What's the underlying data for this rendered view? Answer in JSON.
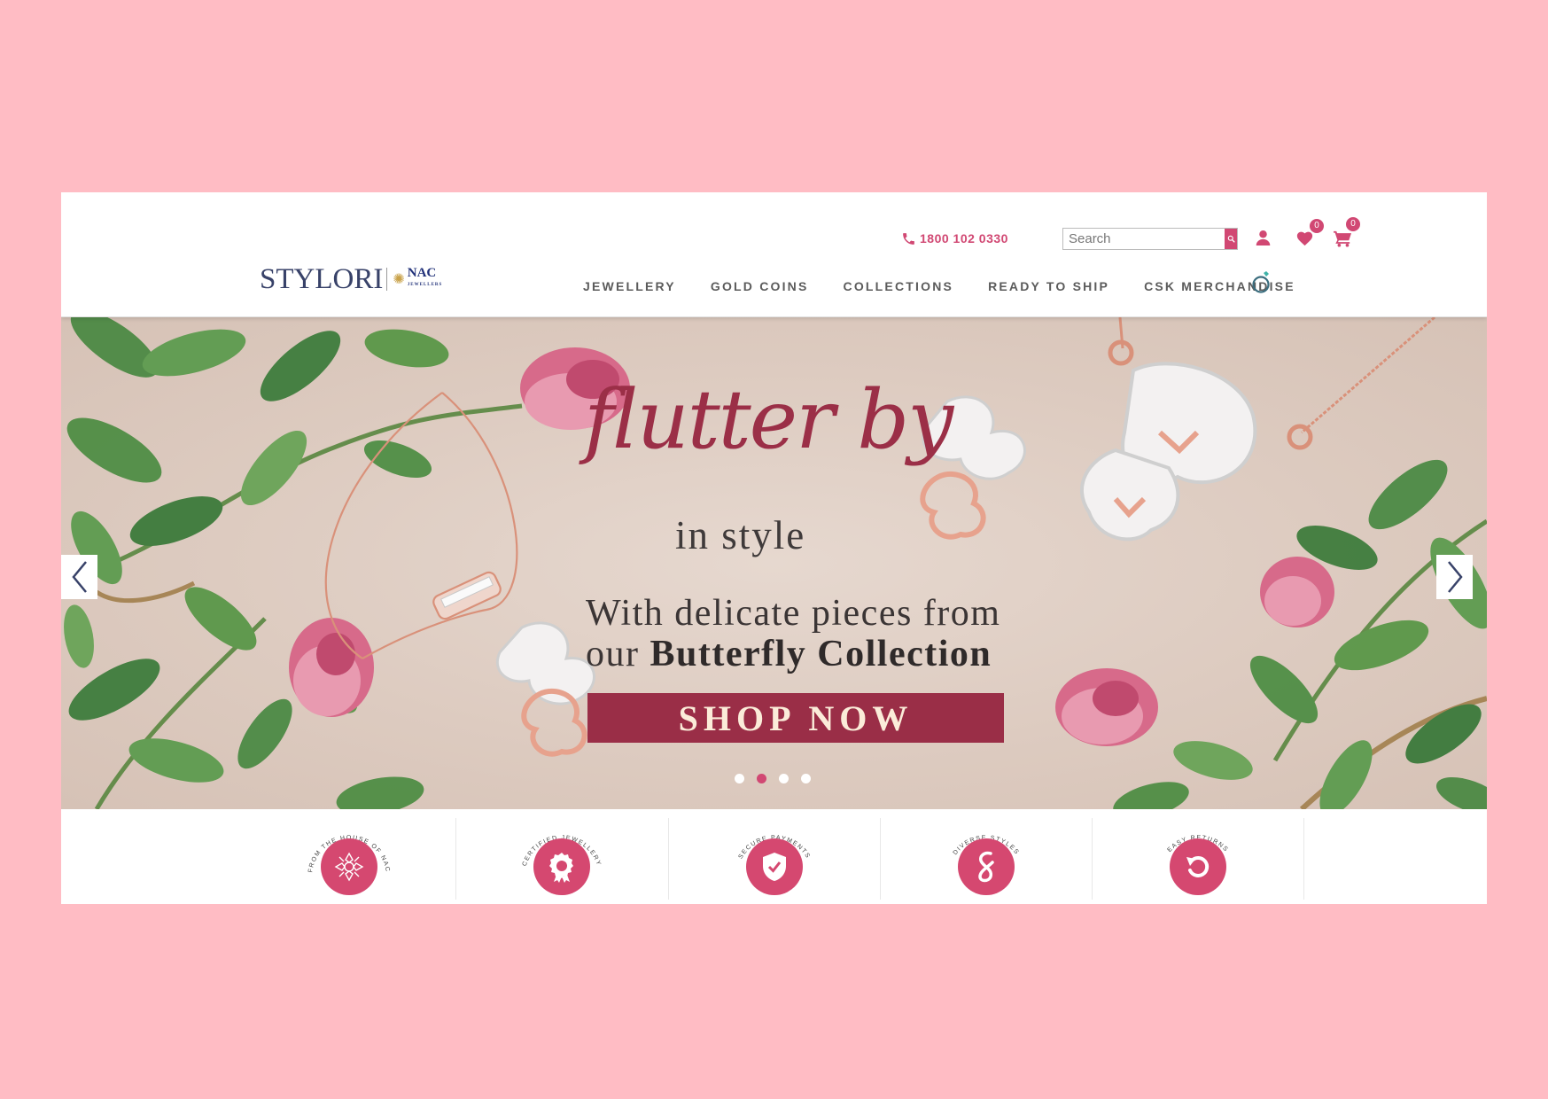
{
  "header": {
    "logo": {
      "brand": "STYLORI",
      "partner": "NAC",
      "partner_sub": "JEWELLERS"
    },
    "phone": "1800 102 0330",
    "search": {
      "placeholder": "Search",
      "value": ""
    },
    "wishlist_count": "0",
    "cart_count": "0",
    "nav": [
      {
        "label": "JEWELLERY"
      },
      {
        "label": "GOLD COINS"
      },
      {
        "label": "COLLECTIONS"
      },
      {
        "label": "READY TO SHIP"
      },
      {
        "label": "CSK MERCHANDISE"
      }
    ]
  },
  "hero": {
    "title": "flutter by",
    "subtitle": "in style",
    "line1": "With delicate pieces from",
    "line2_prefix": "our ",
    "line2_bold": "Butterfly Collection",
    "cta": "SHOP NOW",
    "slides_total": 4,
    "active_slide": 2
  },
  "features": [
    {
      "label": "FROM THE HOUSE OF NAC",
      "icon": "nac-pattern-icon"
    },
    {
      "label": "CERTIFIED JEWELLERY",
      "icon": "certified-badge-icon"
    },
    {
      "label": "SECURE PAYMENTS",
      "icon": "shield-check-icon"
    },
    {
      "label": "DIVERSE STYLES",
      "icon": "diverse-styles-icon"
    },
    {
      "label": "EASY RETURNS",
      "icon": "return-arrow-icon"
    }
  ],
  "colors": {
    "page_background": "#ffbcc4",
    "accent": "#d14873",
    "hero_cta": "#9a2e47",
    "logo_text": "#384269"
  }
}
